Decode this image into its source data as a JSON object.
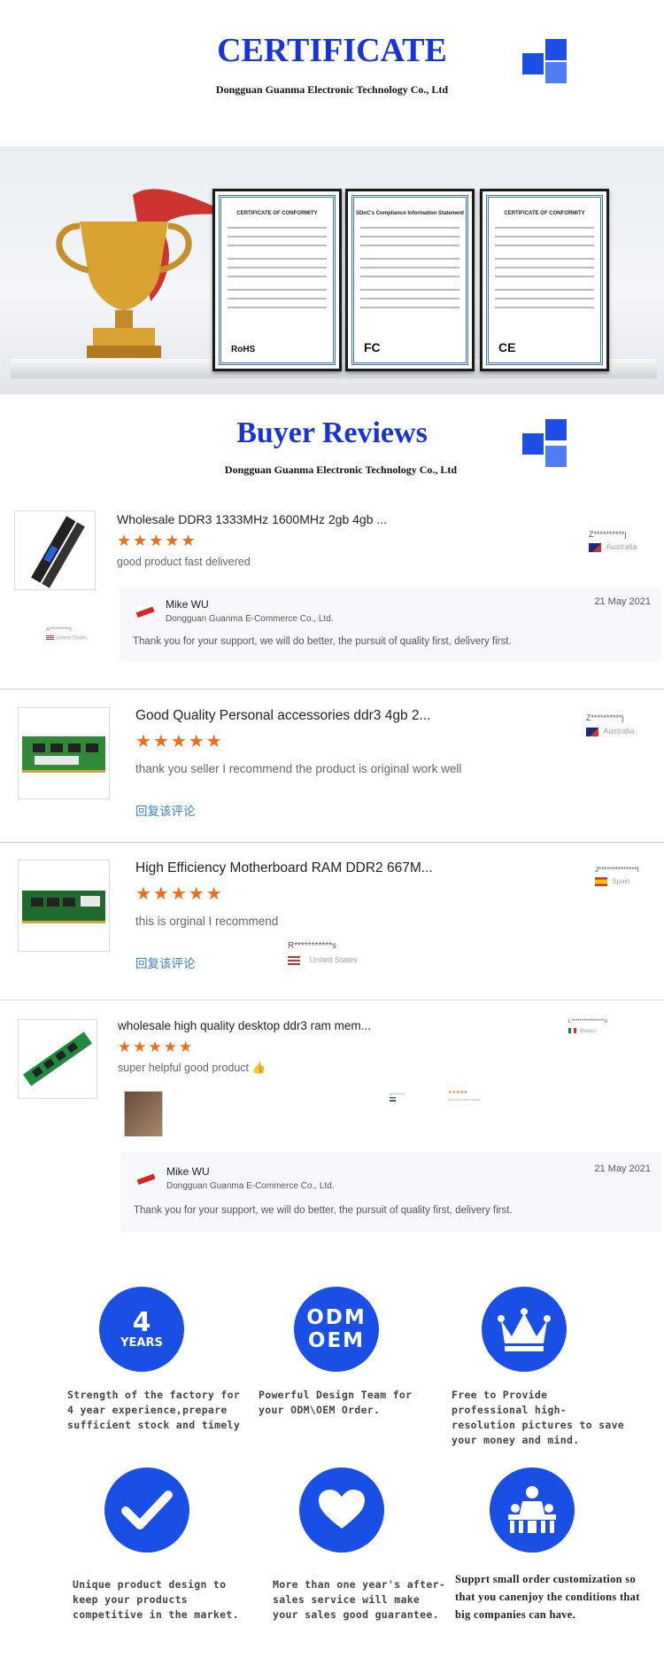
{
  "certificate": {
    "title": "CERTIFICATE",
    "subtitle": "Dongguan Guanma Electronic Technology Co., Ltd",
    "cards": [
      {
        "header": "CERTIFICATE OF CONFORMITY",
        "mark": "RoHS"
      },
      {
        "header": "SDoC's Compliance Information Statement",
        "mark": "FC"
      },
      {
        "header": "CERTIFICATE OF CONFORMITY",
        "mark": "CE"
      }
    ]
  },
  "reviews_section": {
    "title": "Buyer Reviews",
    "subtitle": "Dongguan Guanma Electronic Technology Co., Ltd"
  },
  "reviews": [
    {
      "title": "Wholesale DDR3 1333MHz 1600MHz 2gb 4gb ...",
      "stars": "★★★★★",
      "text": "good product fast delivered",
      "buyer": "Z**********j",
      "country": "Australia",
      "left_buyer": "A**********r",
      "left_country": "United States",
      "reply": {
        "name": "Mike WU",
        "company": "Dongguan Guanma E-Commerce Co., Ltd.",
        "date": "21 May 2021",
        "text": "Thank you for your support, we will do better, the pursuit of quality first, delivery first."
      }
    },
    {
      "title": "Good Quality Personal accessories ddr3 4gb 2...",
      "stars": "★★★★★",
      "text": "thank you seller I recommend the product is original work well",
      "link": "回复该评论",
      "buyer": "Z**********j",
      "country": "Australia"
    },
    {
      "title": "High Efficiency Motherboard RAM DDR2 667M...",
      "stars": "★★★★★",
      "text": "this is orginal I recommend",
      "link": "回复该评论",
      "buyer": "J**************l",
      "country": "Spain",
      "mid_buyer": "R***********s",
      "mid_country": "United States"
    },
    {
      "title": "wholesale high quality desktop ddr3 ram mem...",
      "stars": "★★★★★",
      "text": "super helpful good product 👍",
      "buyer": "L****************o",
      "country": "Mexico",
      "mid_buyer": "k**********",
      "mini_stars": "★★★★★",
      "mini_text": "Accurate description",
      "reply": {
        "name": "Mike WU",
        "company": "Dongguan Guanma E-Commerce Co., Ltd.",
        "date": "21 May 2021",
        "text": "Thank you for your support, we will do better, the pursuit of quality first, delivery first."
      }
    }
  ],
  "features": [
    {
      "icon_name": "four-years-icon",
      "icon_big": "4",
      "icon_small": "YEARS",
      "text": "Strength of the factory for 4 year experience,prepare sufficient stock and timely"
    },
    {
      "icon_name": "odm-oem-icon",
      "icon_big": "ODM",
      "icon_small": "OEM",
      "text": "Powerful Design Team for your ODM\\OEM Order."
    },
    {
      "icon_name": "crown-icon",
      "text": "Free to Provide professional high-resolution pictures to save your money and mind."
    },
    {
      "icon_name": "checkmark-icon",
      "text": "Unique product design to keep your products competitive in the market."
    },
    {
      "icon_name": "heart-icon",
      "text": "More than one year's after-sales service will make your sales good guarantee."
    },
    {
      "icon_name": "people-icon",
      "text": "Supprt small order customization so that you canenjoy the conditions that big companies can have."
    }
  ],
  "colors": {
    "brand_blue": "#1a4fe6",
    "title_blue": "#1a33d6",
    "star_orange": "#ef6c1a"
  }
}
